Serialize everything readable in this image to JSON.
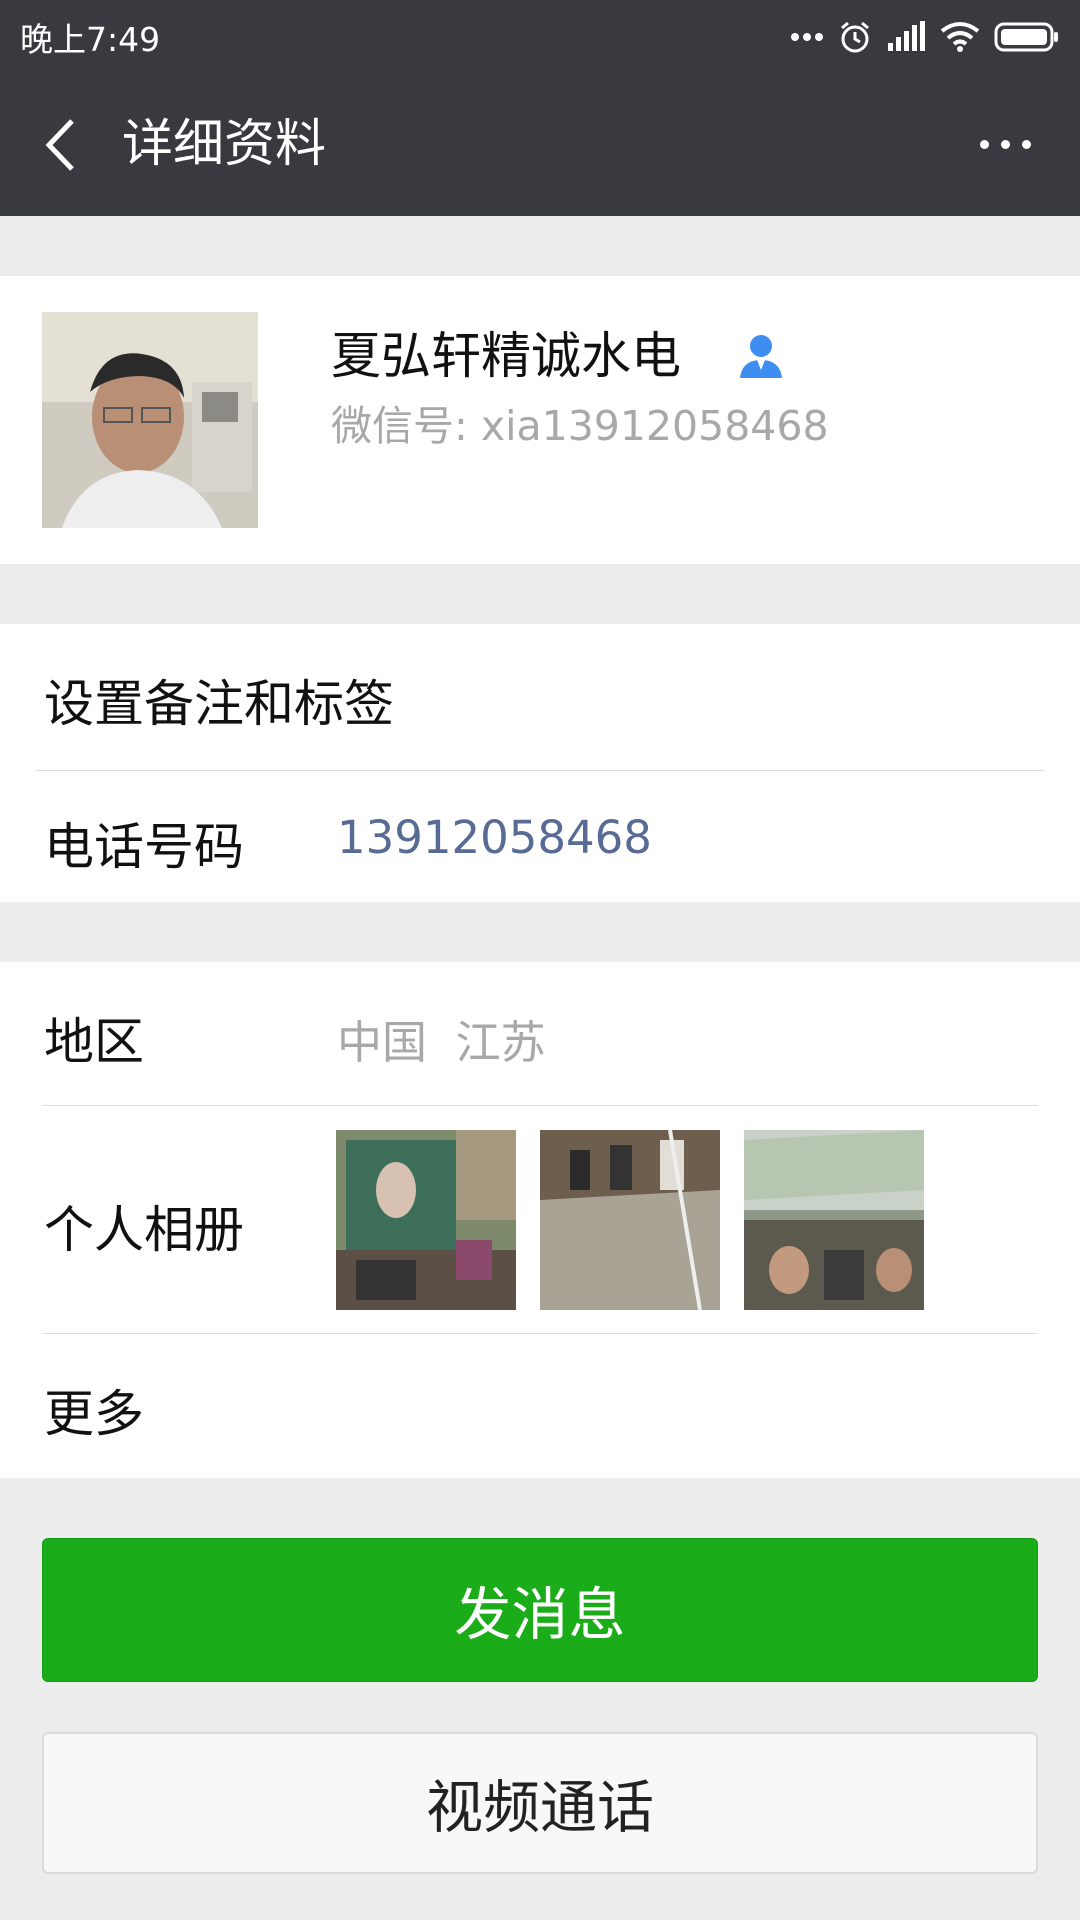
{
  "status_bar": {
    "time": "晚上7:49",
    "icons": [
      "more-dots-icon",
      "alarm-icon",
      "signal-icon",
      "wifi-icon",
      "battery-icon"
    ]
  },
  "header": {
    "back_icon": "chevron-left-icon",
    "title": "详细资料",
    "more_icon": "more-horizontal-icon"
  },
  "profile": {
    "name": "夏弘轩精诚水电",
    "badge_icon": "person-icon",
    "wechat_id": "微信号: xia13912058468"
  },
  "rows": {
    "remark_label": "设置备注和标签",
    "phone_label": "电话号码",
    "phone_value": "13912058468",
    "region_label": "地区",
    "region_value": "中国  江苏",
    "album_label": "个人相册",
    "more_label": "更多"
  },
  "buttons": {
    "send_message": "发消息",
    "video_call": "视频通话"
  },
  "colors": {
    "header_bg": "#393a3f",
    "accent_green": "#1aad19",
    "link_blue": "#576b95",
    "badge_blue": "#3d8ef0"
  }
}
